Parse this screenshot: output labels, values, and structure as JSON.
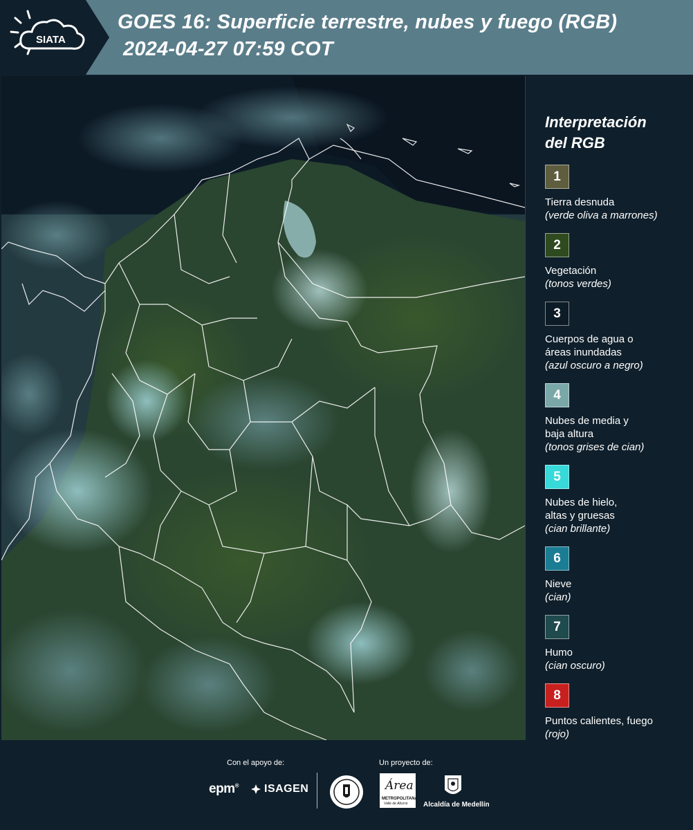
{
  "header": {
    "logo_text": "SIATA",
    "title_line1": "GOES 16: Superficie terrestre, nubes y fuego (RGB)",
    "title_line2": "2024-04-27 07:59 COT"
  },
  "legend": {
    "title_line1": "Interpretación",
    "title_line2": "del RGB",
    "items": [
      {
        "number": "1",
        "color": "#5e5d3e",
        "label": [
          "Tierra desnuda"
        ],
        "sub": "(verde oliva a marrones)"
      },
      {
        "number": "2",
        "color": "#2f4a1f",
        "label": [
          "Vegetación"
        ],
        "sub": "(tonos verdes)"
      },
      {
        "number": "3",
        "color": "#0c1b26",
        "label": [
          "Cuerpos de agua o",
          "áreas inundadas"
        ],
        "sub": "(azul oscuro a negro)"
      },
      {
        "number": "4",
        "color": "#7aa8a9",
        "label": [
          "Nubes de media y",
          "baja altura"
        ],
        "sub": "(tonos grises de cian)"
      },
      {
        "number": "5",
        "color": "#37d9d9",
        "label": [
          "Nubes de hielo,",
          "altas y gruesas"
        ],
        "sub": "(cian brillante)"
      },
      {
        "number": "6",
        "color": "#1b7d94",
        "label": [
          "Nieve"
        ],
        "sub": "(cian)"
      },
      {
        "number": "7",
        "color": "#1f4a4e",
        "label": [
          "Humo"
        ],
        "sub": "(cian oscuro)"
      },
      {
        "number": "8",
        "color": "#c8201f",
        "label": [
          "Puntos calientes, fuego"
        ],
        "sub": "(rojo)"
      }
    ]
  },
  "footer": {
    "support_label": "Con el apoyo de:",
    "project_label": "Un proyecto de:",
    "sponsor1": "epm",
    "sponsor2": "ISAGEN",
    "amva_top": "Área",
    "amva_mid": "METROPOLITANA",
    "amva_bottom": "Valle de Aburrá",
    "alcaldia": "Alcaldía de Medellín"
  },
  "colors": {
    "header_bg": "#5a7d8a",
    "logo_bg": "#0f1f2b",
    "page_bg": "#0f1f2b"
  }
}
